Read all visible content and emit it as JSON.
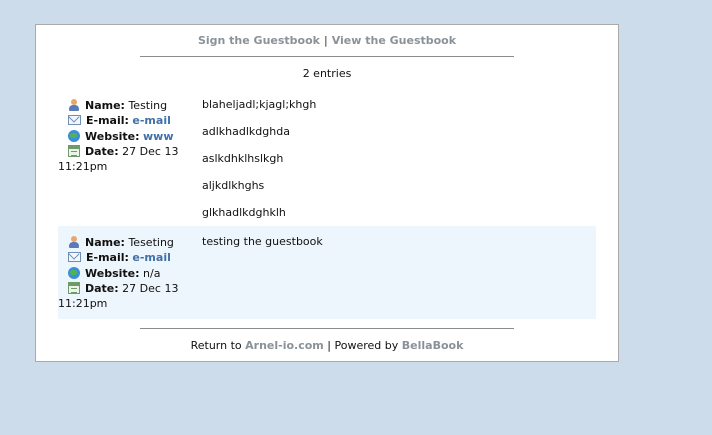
{
  "nav": {
    "sign_label": "Sign the Guestbook",
    "separator": "|",
    "view_label": "View the Guestbook"
  },
  "entries_count": "2 entries",
  "entries": [
    {
      "name_label": "Name:",
      "name": "Testing",
      "email_label": "E-mail:",
      "email": "e-mail",
      "website_label": "Website:",
      "website": "www",
      "date_label": "Date:",
      "date": "27 Dec 13",
      "time": "11:21pm",
      "message": [
        "blaheljadl;kjagl;khgh",
        "adlkhadlkdghda",
        "aslkdhklhslkgh",
        "aljkdlkhghs",
        "glkhadlkdghklh"
      ]
    },
    {
      "name_label": "Name:",
      "name": "Teseting",
      "email_label": "E-mail:",
      "email": "e-mail",
      "website_label": "Website:",
      "website": "n/a",
      "date_label": "Date:",
      "date": "27 Dec 13",
      "time": "11:21pm",
      "message": [
        "testing the guestbook"
      ]
    }
  ],
  "footer": {
    "return_text": "Return to",
    "site_link": "Arnel-io.com",
    "separator": "|",
    "powered_text": "Powered by",
    "powered_link": "BellaBook"
  },
  "colors": {
    "page_background": "#ccdcea",
    "link_grey": "#8a9299",
    "link_blue": "#4170a8",
    "alt_row": "#eef6fd"
  }
}
